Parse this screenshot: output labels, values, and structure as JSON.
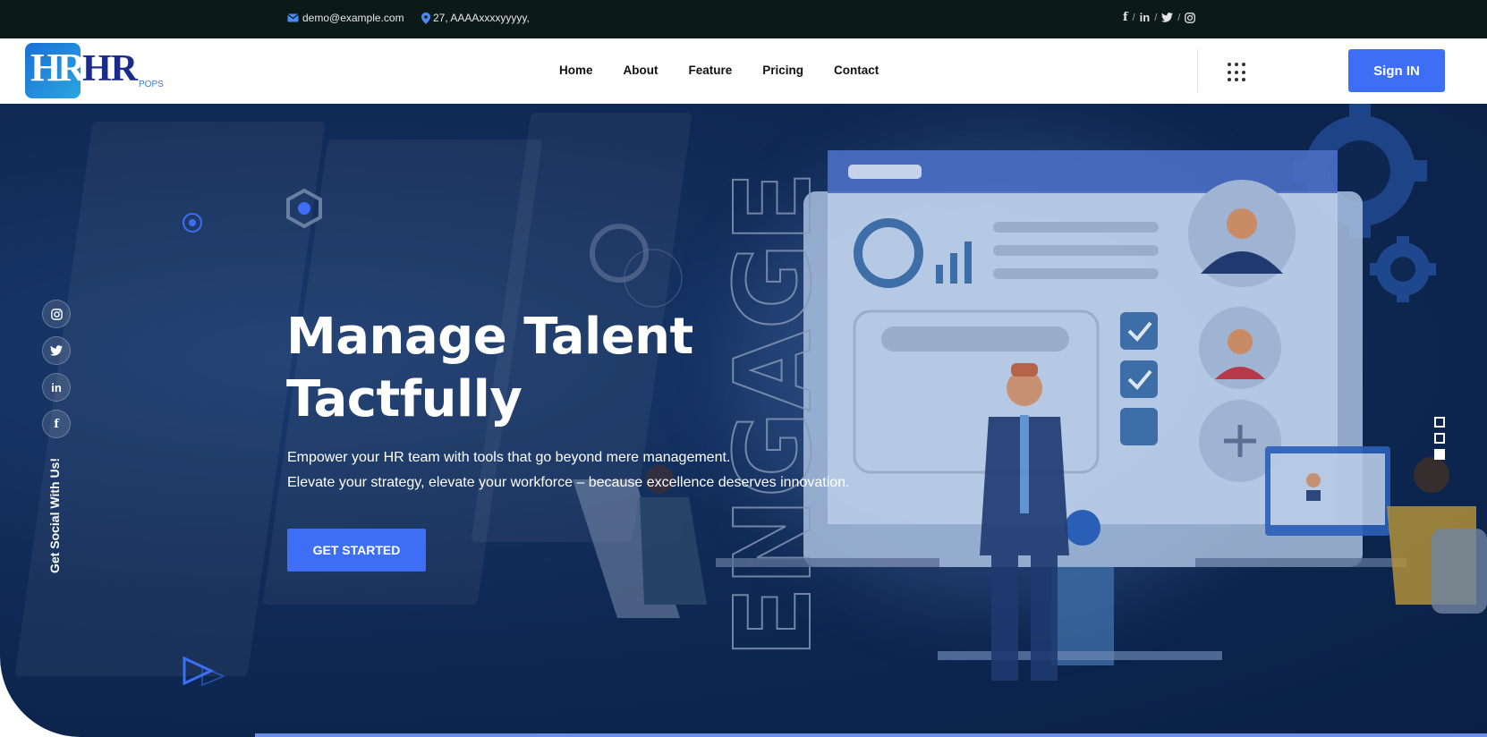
{
  "topbar": {
    "email": "demo@example.com",
    "address": "27, AAAAxxxxyyyyy,",
    "socials": [
      "facebook-icon",
      "linkedin-icon",
      "twitter-icon",
      "instagram-icon"
    ],
    "separator": "/"
  },
  "header": {
    "logo_mono": "HR",
    "logo_word": "HR",
    "logo_sub": "POPS",
    "nav": [
      "Home",
      "About",
      "Feature",
      "Pricing",
      "Contact"
    ],
    "signin_label": "Sign IN"
  },
  "hero": {
    "title_line1": "Manage Talent",
    "title_line2": "Tactfully",
    "text_line1": "Empower your HR team with tools that go beyond mere management.",
    "text_line2": "Elevate your strategy, elevate your workforce – because excellence deserves innovation.",
    "cta_label": "GET STARTED",
    "engage_text": "ENGAGE",
    "side_label": "Get Social With Us!",
    "side_icons": [
      "instagram-icon",
      "twitter-icon",
      "linkedin-icon",
      "facebook-icon"
    ],
    "slide_count": 3,
    "active_slide": 3
  },
  "colors": {
    "accent": "#3d6ef5",
    "topbar_bg": "#0c1a17",
    "hero_bg": "#0f2a55",
    "logo_text": "#1a2b8c"
  }
}
